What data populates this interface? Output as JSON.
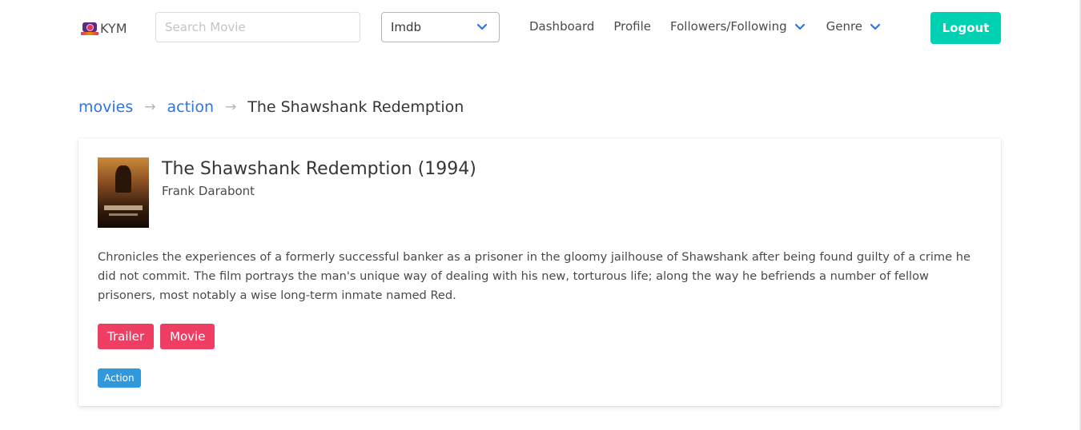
{
  "navbar": {
    "brand": "KYM",
    "search_placeholder": "Search Movie",
    "source_select": "Imdb",
    "links": {
      "dashboard": "Dashboard",
      "profile": "Profile",
      "followers": "Followers/Following",
      "genre": "Genre"
    },
    "logout": "Logout"
  },
  "breadcrumb": {
    "items": [
      "movies",
      "action"
    ],
    "separator": "→",
    "current": "The Shawshank Redemption"
  },
  "movie": {
    "title": "The Shawshank Redemption (1994)",
    "director": "Frank Darabont",
    "description": "Chronicles the experiences of a formerly successful banker as a prisoner in the gloomy jailhouse of Shawshank after being found guilty of a crime he did not commit. The film portrays the man's unique way of dealing with his new, torturous life; along the way he befriends a number of fellow prisoners, most notably a wise long-term inmate named Red.",
    "buttons": [
      "Trailer",
      "Movie"
    ],
    "genre": "Action"
  },
  "colors": {
    "primary": "#00d1b2",
    "link": "#3273dc",
    "danger": "#ef3e63",
    "info": "#3298dc"
  }
}
